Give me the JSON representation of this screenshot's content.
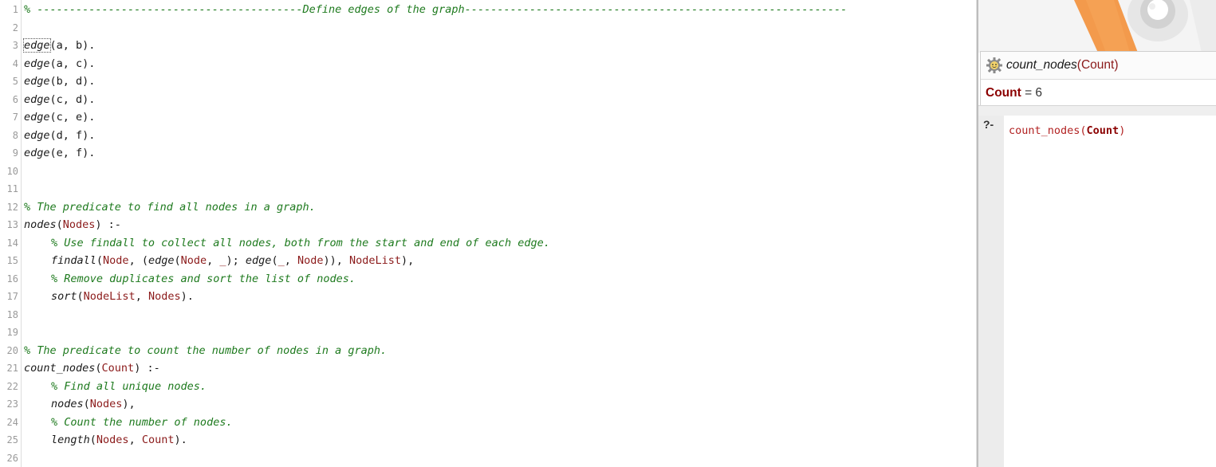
{
  "editor": {
    "lines": [
      {
        "n": "1",
        "tokens": [
          {
            "c": "cmt",
            "t": "% -----------------------------------------Define edges of the graph-----------------------------------------------------------"
          }
        ]
      },
      {
        "n": "2",
        "tokens": []
      },
      {
        "n": "3",
        "tokens": [
          {
            "c": "fn cursor-word",
            "t": "edge"
          },
          {
            "c": "pun",
            "t": "(a, b)."
          }
        ]
      },
      {
        "n": "4",
        "tokens": [
          {
            "c": "fn",
            "t": "edge"
          },
          {
            "c": "pun",
            "t": "(a, c)."
          }
        ]
      },
      {
        "n": "5",
        "tokens": [
          {
            "c": "fn",
            "t": "edge"
          },
          {
            "c": "pun",
            "t": "(b, d)."
          }
        ]
      },
      {
        "n": "6",
        "tokens": [
          {
            "c": "fn",
            "t": "edge"
          },
          {
            "c": "pun",
            "t": "(c, d)."
          }
        ]
      },
      {
        "n": "7",
        "tokens": [
          {
            "c": "fn",
            "t": "edge"
          },
          {
            "c": "pun",
            "t": "(c, e)."
          }
        ]
      },
      {
        "n": "8",
        "tokens": [
          {
            "c": "fn",
            "t": "edge"
          },
          {
            "c": "pun",
            "t": "(d, f)."
          }
        ]
      },
      {
        "n": "9",
        "tokens": [
          {
            "c": "fn",
            "t": "edge"
          },
          {
            "c": "pun",
            "t": "(e, f)."
          }
        ]
      },
      {
        "n": "10",
        "tokens": []
      },
      {
        "n": "11",
        "tokens": []
      },
      {
        "n": "12",
        "tokens": [
          {
            "c": "cmt",
            "t": "% The predicate to find all nodes in a graph."
          }
        ]
      },
      {
        "n": "13",
        "tokens": [
          {
            "c": "fn",
            "t": "nodes"
          },
          {
            "c": "pun",
            "t": "("
          },
          {
            "c": "var",
            "t": "Nodes"
          },
          {
            "c": "pun",
            "t": ") :-"
          }
        ]
      },
      {
        "n": "14",
        "indent": true,
        "tokens": [
          {
            "c": "cmt",
            "t": "% Use findall to collect all nodes, both from the start and end of each edge."
          }
        ]
      },
      {
        "n": "15",
        "indent": true,
        "tokens": [
          {
            "c": "fn",
            "t": "findall"
          },
          {
            "c": "pun",
            "t": "("
          },
          {
            "c": "var",
            "t": "Node"
          },
          {
            "c": "pun",
            "t": ", ("
          },
          {
            "c": "fn",
            "t": "edge"
          },
          {
            "c": "pun",
            "t": "("
          },
          {
            "c": "var",
            "t": "Node"
          },
          {
            "c": "pun",
            "t": ", "
          },
          {
            "c": "var",
            "t": "_"
          },
          {
            "c": "pun",
            "t": "); "
          },
          {
            "c": "fn",
            "t": "edge"
          },
          {
            "c": "pun",
            "t": "("
          },
          {
            "c": "var",
            "t": "_"
          },
          {
            "c": "pun",
            "t": ", "
          },
          {
            "c": "var",
            "t": "Node"
          },
          {
            "c": "pun",
            "t": ")), "
          },
          {
            "c": "var",
            "t": "NodeList"
          },
          {
            "c": "pun",
            "t": "),"
          }
        ]
      },
      {
        "n": "16",
        "indent": true,
        "tokens": [
          {
            "c": "cmt",
            "t": "% Remove duplicates and sort the list of nodes."
          }
        ]
      },
      {
        "n": "17",
        "indent": true,
        "tokens": [
          {
            "c": "fn",
            "t": "sort"
          },
          {
            "c": "pun",
            "t": "("
          },
          {
            "c": "var",
            "t": "NodeList"
          },
          {
            "c": "pun",
            "t": ", "
          },
          {
            "c": "var",
            "t": "Nodes"
          },
          {
            "c": "pun",
            "t": ")."
          }
        ]
      },
      {
        "n": "18",
        "tokens": []
      },
      {
        "n": "19",
        "tokens": []
      },
      {
        "n": "20",
        "tokens": [
          {
            "c": "cmt",
            "t": "% The predicate to count the number of nodes in a graph."
          }
        ]
      },
      {
        "n": "21",
        "tokens": [
          {
            "c": "fn",
            "t": "count_nodes"
          },
          {
            "c": "pun",
            "t": "("
          },
          {
            "c": "var",
            "t": "Count"
          },
          {
            "c": "pun",
            "t": ") :-"
          }
        ]
      },
      {
        "n": "22",
        "indent": true,
        "tokens": [
          {
            "c": "cmt",
            "t": "% Find all unique nodes."
          }
        ]
      },
      {
        "n": "23",
        "indent": true,
        "tokens": [
          {
            "c": "fn",
            "t": "nodes"
          },
          {
            "c": "pun",
            "t": "("
          },
          {
            "c": "var",
            "t": "Nodes"
          },
          {
            "c": "pun",
            "t": "),"
          }
        ]
      },
      {
        "n": "24",
        "indent": true,
        "tokens": [
          {
            "c": "cmt",
            "t": "% Count the number of nodes."
          }
        ]
      },
      {
        "n": "25",
        "indent": true,
        "tokens": [
          {
            "c": "fn",
            "t": "length"
          },
          {
            "c": "pun",
            "t": "("
          },
          {
            "c": "var",
            "t": "Nodes"
          },
          {
            "c": "pun",
            "t": ", "
          },
          {
            "c": "var",
            "t": "Count"
          },
          {
            "c": "pun",
            "t": ")."
          }
        ]
      },
      {
        "n": "26",
        "tokens": []
      }
    ]
  },
  "answer": {
    "query_name": "count_nodes",
    "query_open": "(",
    "query_arg": "Count",
    "query_close": ")",
    "result_var": "Count",
    "result_eq": " = 6"
  },
  "query": {
    "prompt": "?-",
    "name": "count_nodes(",
    "var": "Count",
    "close": ")"
  },
  "colors": {
    "comment": "#1e7a1e",
    "variable": "#8b1a1a",
    "line_number": "#9a9a9a"
  }
}
